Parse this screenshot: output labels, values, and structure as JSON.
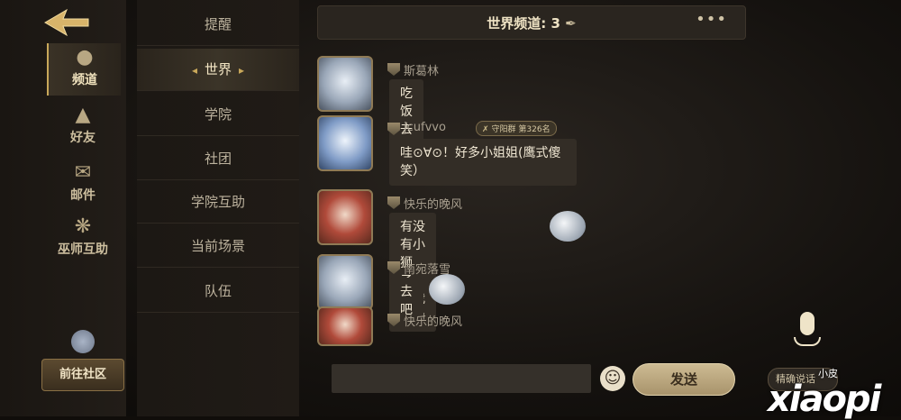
{
  "rail": {
    "items": [
      {
        "label": "频道",
        "icon": "chat-bubble-icon"
      },
      {
        "label": "好友",
        "icon": "wizard-hat-icon"
      },
      {
        "label": "邮件",
        "icon": "envelope-icon"
      },
      {
        "label": "巫师互助",
        "icon": "helping-hands-icon"
      }
    ],
    "community_label": "前往社区"
  },
  "categories": [
    "提醒",
    "世界",
    "学院",
    "社团",
    "学院互助",
    "当前场景",
    "队伍"
  ],
  "active_category": "世界",
  "header": {
    "title": "世界频道: 3",
    "more": "•••"
  },
  "messages": [
    {
      "name": "斯葛林",
      "text": "吃饭去了",
      "rank": ""
    },
    {
      "name": "jcufvvo",
      "text_line1": "哇⊙∀⊙！好多小姐姐(鹰式傻",
      "text_line2": "笑）",
      "rank": "守阳群 第326名"
    },
    {
      "name": "快乐的晚风",
      "text": "有没有小狮子，借我围巾",
      "rank": ""
    },
    {
      "name": "南宛落雪",
      "text": "去吧",
      "rank": ""
    },
    {
      "name": "快乐的晚风",
      "text": "",
      "rank": ""
    }
  ],
  "input": {
    "placeholder": "",
    "send_label": "发送"
  },
  "voice_label": "精确说话",
  "watermark": {
    "big": "xiaopi",
    "small": "小皮"
  }
}
